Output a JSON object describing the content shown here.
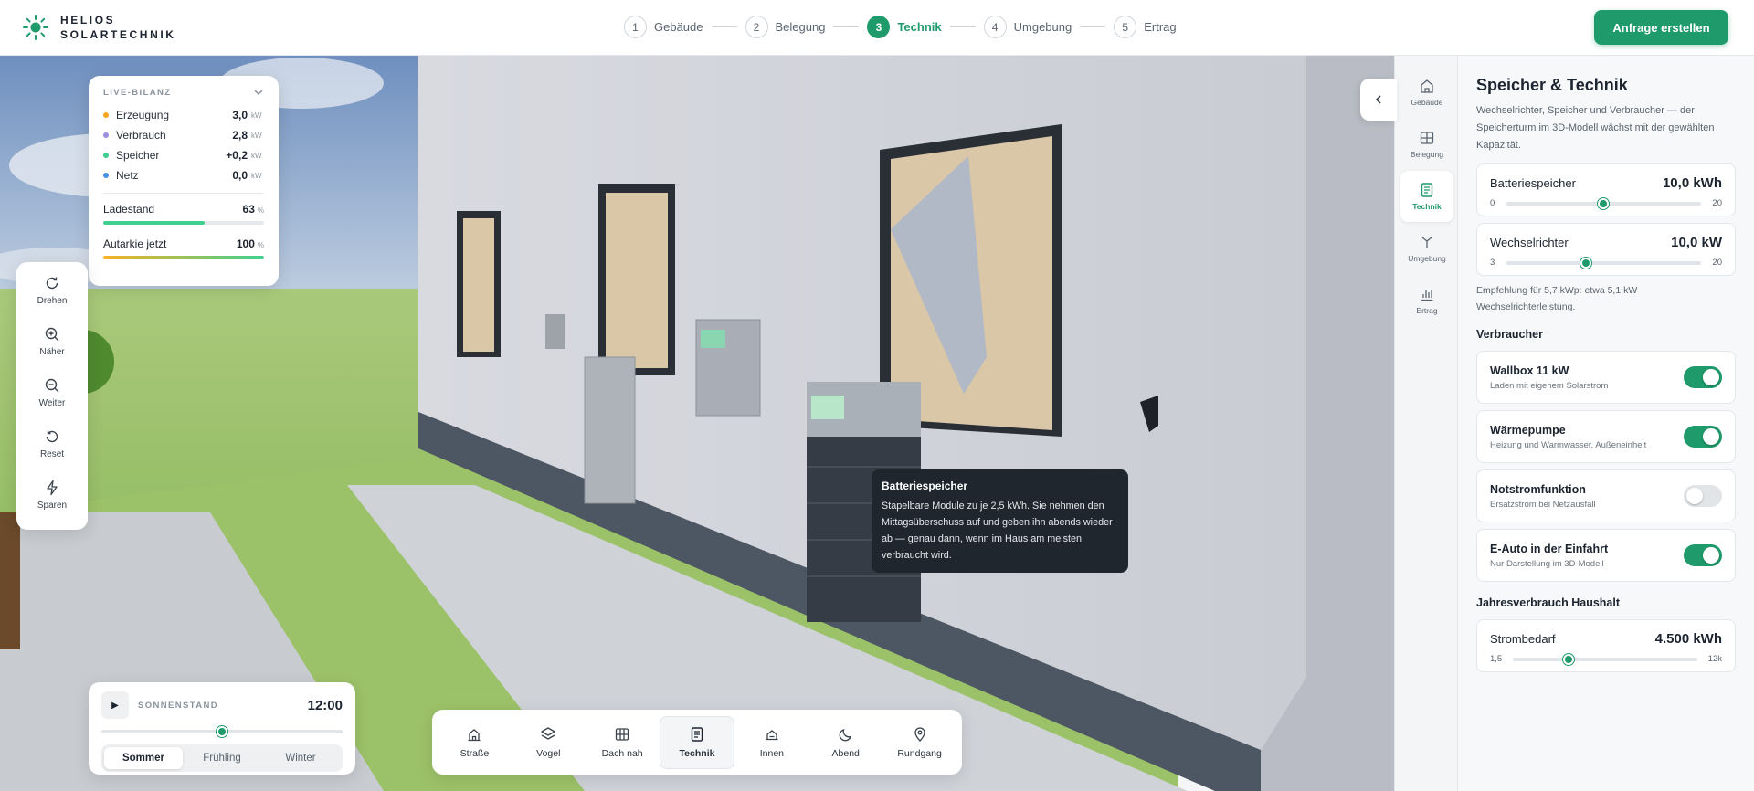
{
  "brand": {
    "line1": "HELIOS",
    "line2": "SOLARTECHNIK"
  },
  "steps": [
    {
      "num": "1",
      "label": "Gebäude"
    },
    {
      "num": "2",
      "label": "Belegung"
    },
    {
      "num": "3",
      "label": "Technik"
    },
    {
      "num": "4",
      "label": "Umgebung"
    },
    {
      "num": "5",
      "label": "Ertrag"
    }
  ],
  "active_step": 3,
  "cta_label": "Anfrage erstellen",
  "bilanz": {
    "title": "LIVE-BILANZ",
    "rows": [
      {
        "label": "Erzeugung",
        "value": "3,0",
        "unit": "kW",
        "color": "#f5a524"
      },
      {
        "label": "Verbrauch",
        "value": "2,8",
        "unit": "kW",
        "color": "#9b8fe0"
      },
      {
        "label": "Speicher",
        "value": "+0,2",
        "unit": "kW",
        "color": "#3fcf8e"
      },
      {
        "label": "Netz",
        "value": "0,0",
        "unit": "kW",
        "color": "#4a90e2"
      }
    ],
    "ladestand": {
      "label": "Ladestand",
      "value": "63",
      "unit": "%",
      "fraction": 0.63,
      "color": "#3fcf8e"
    },
    "autarkie": {
      "label": "Autarkie jetzt",
      "value": "100",
      "unit": "%",
      "fraction": 1.0,
      "color": "#f5b324",
      "color2": "#3fcf8e"
    }
  },
  "tools": [
    "Drehen",
    "Näher",
    "Weiter",
    "Reset",
    "Sparen"
  ],
  "sun": {
    "label": "SONNENSTAND",
    "time": "12:00",
    "position": 0.5,
    "seasons": [
      "Sommer",
      "Frühling",
      "Winter"
    ],
    "active_season": "Sommer"
  },
  "views": [
    "Straße",
    "Vogel",
    "Dach nah",
    "Technik",
    "Innen",
    "Abend",
    "Rundgang"
  ],
  "active_view": "Technik",
  "tooltip": {
    "title": "Batteriespeicher",
    "text": "Stapelbare Module zu je 2,5 kWh. Sie nehmen den Mittagsüberschuss auf und geben ihn abends wieder ab — genau dann, wenn im Haus am meisten verbraucht wird."
  },
  "rail": [
    "Gebäude",
    "Belegung",
    "Technik",
    "Umgebung",
    "Ertrag"
  ],
  "active_rail": "Technik",
  "panel": {
    "title": "Speicher & Technik",
    "desc": "Wechselrichter, Speicher und Verbraucher — der Speicherturm im 3D-Modell wächst mit der gewählten Kapazität.",
    "sliders": [
      {
        "label": "Batteriespeicher",
        "value": "10,0 kWh",
        "min": "0",
        "max": "20",
        "position": 0.5
      },
      {
        "label": "Wechselrichter",
        "value": "10,0 kW",
        "min": "3",
        "max": "20",
        "position": 0.41
      }
    ],
    "note": "Empfehlung für 5,7 kWp: etwa 5,1 kW Wechselrichterleistung.",
    "verbraucher_title": "Verbraucher",
    "toggles": [
      {
        "title": "Wallbox 11 kW",
        "sub": "Laden mit eigenem Solarstrom",
        "on": true
      },
      {
        "title": "Wärmepumpe",
        "sub": "Heizung und Warmwasser, Außeneinheit",
        "on": true
      },
      {
        "title": "Notstromfunktion",
        "sub": "Ersatzstrom bei Netzausfall",
        "on": false
      },
      {
        "title": "E-Auto in der Einfahrt",
        "sub": "Nur Darstellung im 3D-Modell",
        "on": true
      }
    ],
    "jahres_title": "Jahresverbrauch Haushalt",
    "strom": {
      "label": "Strombedarf",
      "value": "4.500 kWh",
      "min": "1,5",
      "max": "12k",
      "position": 0.3
    }
  },
  "colors": {
    "accent": "#1f9a6b",
    "accent_light": "#3fcf8e",
    "tooltip_bg": "#20262d"
  }
}
